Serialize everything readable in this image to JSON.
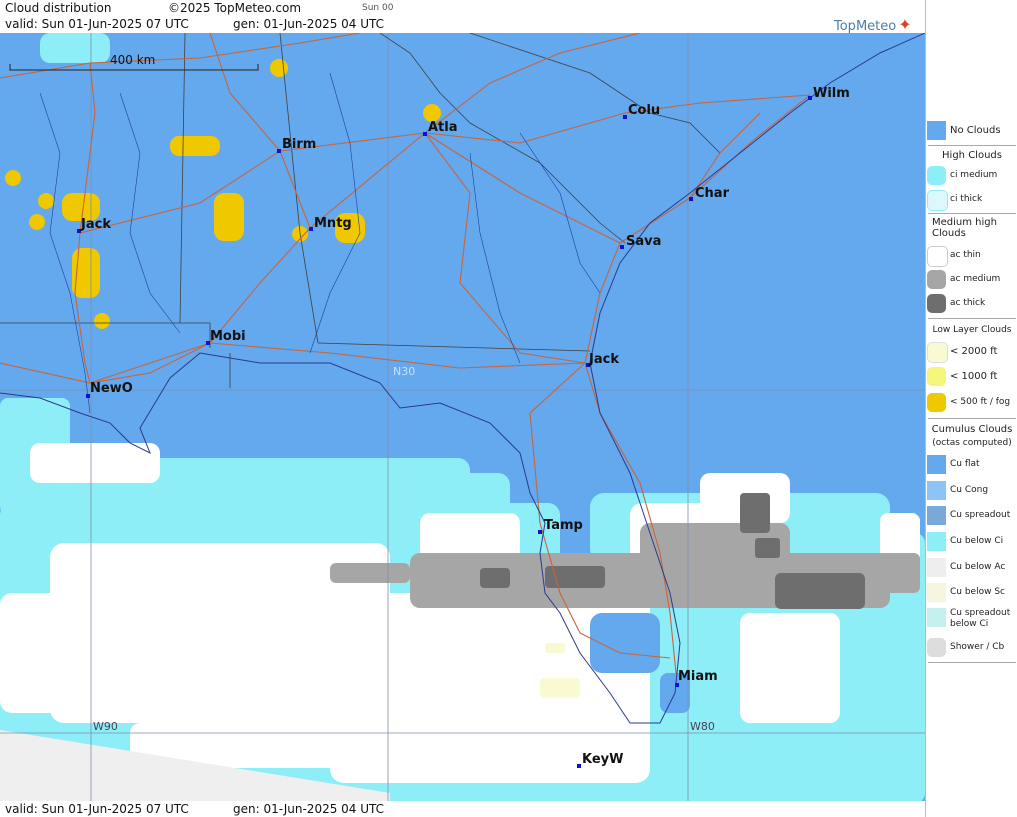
{
  "header": {
    "title": "Cloud distribution",
    "copyright": "©2025 TopMeteo.com",
    "day_code": "Sun 00",
    "valid": "valid:  Sun  01-Jun-2025  07 UTC",
    "gen": "gen: 01-Jun-2025 04 UTC",
    "logo": "TopMeteo"
  },
  "footer": {
    "valid": "valid:  Sun  01-Jun-2025  07 UTC",
    "gen": "gen: 01-Jun-2025 04 UTC"
  },
  "map": {
    "scale_label": "400 km",
    "grid_labels": {
      "lat_n30": "N30",
      "lon_w90": "W90",
      "lon_w80": "W80"
    },
    "cities": [
      {
        "id": "wilm",
        "label": "Wilm"
      },
      {
        "id": "colu",
        "label": "Colu"
      },
      {
        "id": "atla",
        "label": "Atla"
      },
      {
        "id": "birm",
        "label": "Birm"
      },
      {
        "id": "char",
        "label": "Char"
      },
      {
        "id": "jack-ms",
        "label": "Jack"
      },
      {
        "id": "mntg",
        "label": "Mntg"
      },
      {
        "id": "sava",
        "label": "Sava"
      },
      {
        "id": "mobi",
        "label": "Mobi"
      },
      {
        "id": "jack-fl",
        "label": "Jack"
      },
      {
        "id": "newo",
        "label": "NewO"
      },
      {
        "id": "tamp",
        "label": "Tamp"
      },
      {
        "id": "miam",
        "label": "Miam"
      },
      {
        "id": "keyw",
        "label": "KeyW"
      }
    ],
    "colors": {
      "no_clouds": "#64a8ee",
      "ci_medium": "#8eeef8",
      "ci_thick": "#dcf8fc",
      "ac_thin": "#ffffff",
      "ac_medium": "#a6a6a6",
      "ac_thick": "#6e6e6e",
      "low_2000": "#fafad2",
      "low_1000": "#f5f57a",
      "low_500": "#f0c800",
      "outside": "#efefef",
      "roads": "#c8643c",
      "borders": "#404040",
      "coast": "#2a3a8a"
    }
  },
  "legend": {
    "no_clouds": "No Clouds",
    "high_clouds": "High Clouds",
    "ci_medium": "ci medium",
    "ci_thick": "ci thick",
    "medium_high": "Medium high Clouds",
    "ac_thin": "ac thin",
    "ac_medium": "ac medium",
    "ac_thick": "ac thick",
    "low_layer": "Low Layer Clouds",
    "low_2000": "< 2000 ft",
    "low_1000": "< 1000 ft",
    "low_500": "< 500 ft / fog",
    "cumulus": "Cumulus Clouds",
    "octas": "(octas computed)",
    "cu_flat": "Cu flat",
    "cu_cong": "Cu Cong",
    "cu_spreadout": "Cu spreadout",
    "cu_below_ci": "Cu below Ci",
    "cu_below_ac": "Cu below Ac",
    "cu_below_sc": "Cu below Sc",
    "cu_spreadout_below_ci": "Cu spreadout below Ci",
    "shower_cb": "Shower / Cb"
  }
}
